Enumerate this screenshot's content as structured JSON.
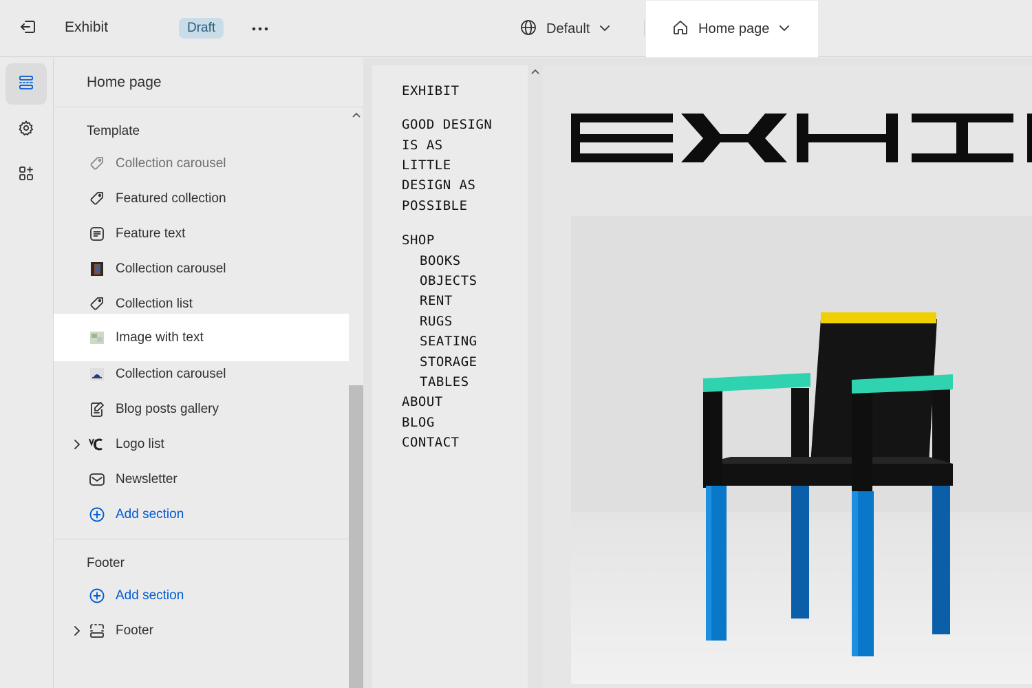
{
  "topbar": {
    "app_name": "Exhibit",
    "status_badge": "Draft",
    "language_select": "Default",
    "page_select": "Home page"
  },
  "sidebar": {
    "title": "Home page",
    "template_heading": "Template",
    "template_sections": [
      {
        "label": "Collection carousel",
        "icon": "tag-icon"
      },
      {
        "label": "Featured collection",
        "icon": "tag-icon"
      },
      {
        "label": "Feature text",
        "icon": "text-block-icon"
      },
      {
        "label": "Collection carousel",
        "icon": "image-thumbnail-icon"
      },
      {
        "label": "Collection list",
        "icon": "tag-icon"
      },
      {
        "label": "Image with text",
        "icon": "image-thumbnail-icon"
      },
      {
        "label": "Collection carousel",
        "icon": "image-thumbnail-icon"
      },
      {
        "label": "Blog posts gallery",
        "icon": "blog-post-icon"
      },
      {
        "label": "Logo list",
        "icon": "logo-thumbnail-icon"
      },
      {
        "label": "Newsletter",
        "icon": "email-icon"
      }
    ],
    "template_add_section": "Add section",
    "footer_heading": "Footer",
    "footer_add_section": "Add section",
    "footer_sections": [
      {
        "label": "Footer",
        "icon": "footer-layout-icon"
      }
    ]
  },
  "preview": {
    "store_name": "EXHIBIT",
    "tagline_lines": [
      "GOOD DESIGN",
      "IS AS",
      "LITTLE",
      "DESIGN AS",
      "POSSIBLE"
    ],
    "nav": {
      "shop": "SHOP",
      "shop_children": [
        "BOOKS",
        "OBJECTS",
        "RENT",
        "RUGS",
        "SEATING",
        "STORAGE",
        "TABLES"
      ],
      "about": "ABOUT",
      "blog": "BLOG",
      "contact": "CONTACT"
    },
    "logo_text": "EXHIBIT"
  },
  "colors": {
    "accent_blue": "#005bd3",
    "draft_badge_bg": "#c8dde8",
    "chair_seat_top": "#f0d000",
    "chair_arms": "#2fd3b0",
    "chair_legs": "#0a78c8"
  }
}
